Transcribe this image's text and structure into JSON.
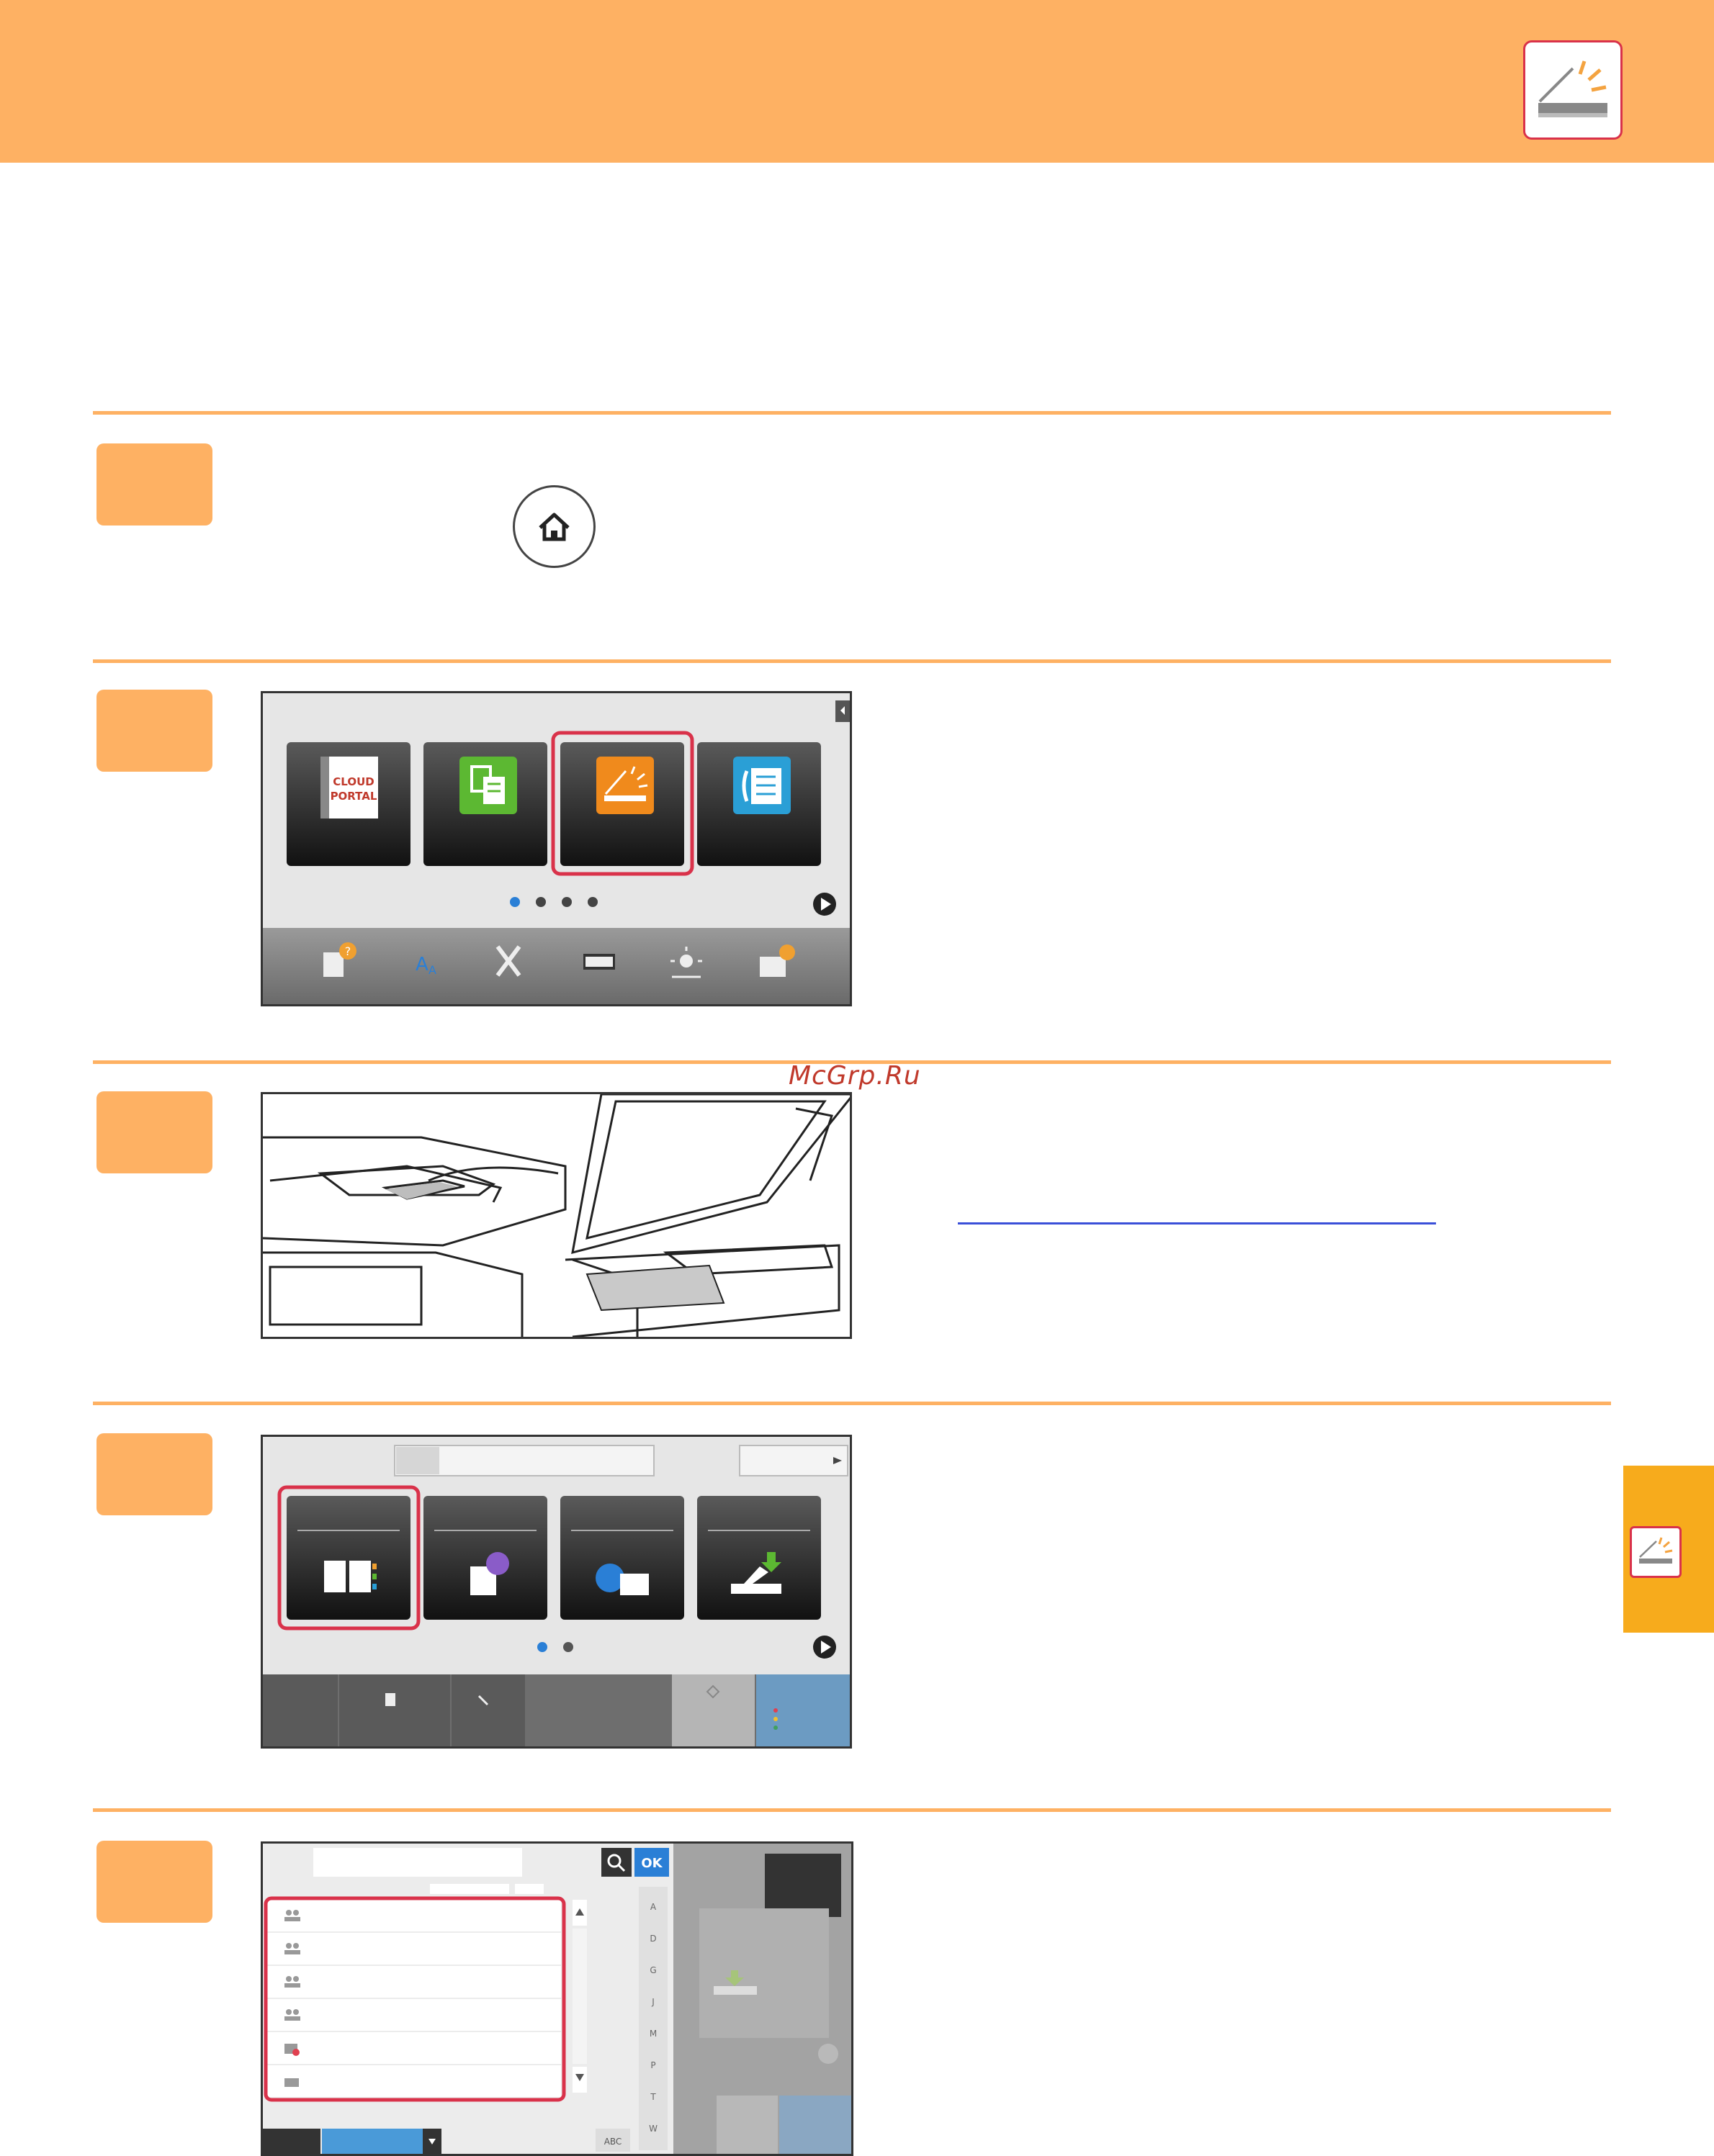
{
  "header": {
    "icon": "scanner-icon"
  },
  "watermark": "McGrp.Ru",
  "step1": {
    "icon": "home-icon"
  },
  "step2": {
    "tiles": [
      {
        "name": "cloud-portal-tile",
        "text": "CLOUD PORTAL"
      },
      {
        "name": "copy-tile",
        "icon": "copy-icon"
      },
      {
        "name": "scan-tile",
        "icon": "scanner-icon",
        "highlighted": true
      },
      {
        "name": "fax-tile",
        "icon": "fax-icon"
      }
    ],
    "page_dots": 4,
    "active_dot": 0,
    "bottom_icons": [
      "help-icon",
      "language-icon",
      "settings-icon",
      "counter-icon",
      "brightness-icon",
      "job-status-icon"
    ]
  },
  "step4": {
    "tiles": [
      {
        "name": "address-book-tile",
        "icon": "address-book-icon",
        "highlighted": true
      },
      {
        "name": "history-tile",
        "icon": "history-icon"
      },
      {
        "name": "global-search-tile",
        "icon": "global-search-icon"
      },
      {
        "name": "usb-tile",
        "icon": "usb-icon"
      }
    ],
    "page_dots": 2,
    "active_dot": 0
  },
  "step5": {
    "ok_label": "OK",
    "abc_label": "ABC",
    "index_letters": [
      "A",
      "D",
      "G",
      "J",
      "M",
      "P",
      "T",
      "W"
    ],
    "list_icons": [
      "group-icon",
      "group-icon",
      "group-icon",
      "group-icon",
      "fax-address-icon",
      "email-icon"
    ]
  },
  "colors": {
    "accent": "#feb163",
    "highlight": "#d9324a",
    "side_tab": "#f7ab1c",
    "link": "#3a4fd8"
  }
}
